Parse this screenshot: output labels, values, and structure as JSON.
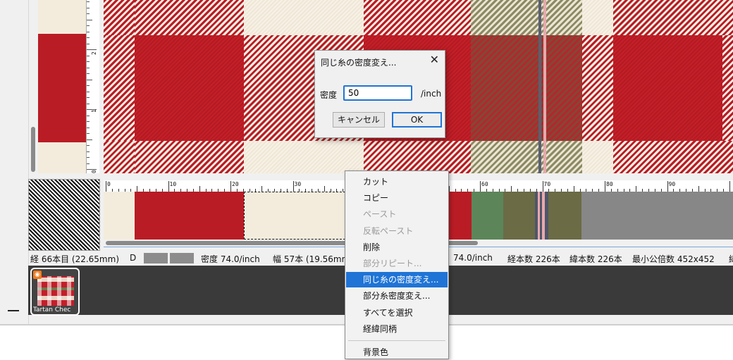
{
  "colors": {
    "red": "#b91c25",
    "cream": "#f3ecdd",
    "olive": "#6b6b45",
    "green": "#5c865a",
    "gray": "#878787",
    "accent": "#1f74d6"
  },
  "ruler_vertical": {
    "labels": [
      "2",
      "1",
      "0"
    ]
  },
  "ruler_horizontal": {
    "labels": [
      "0",
      "10",
      "20",
      "30",
      "40",
      "50",
      "60",
      "70",
      "80",
      "90"
    ]
  },
  "status": {
    "warp": "経 66本目 (22.65mm)",
    "d_label": "D",
    "density": "密度 74.0/inch",
    "width": "幅 57本 (19.56mm)",
    "density2": "74.0/inch",
    "warp_count": "経本数 226本",
    "weft_count": "緯本数 226本",
    "lcm": "最小公倍数 452x452",
    "trailing": "緯"
  },
  "gallery": {
    "items": [
      {
        "label": "Tartan Chec",
        "badge_icon": "app-badge-icon"
      }
    ]
  },
  "dialog": {
    "title": "同じ糸の密度変え...",
    "close_glyph": "✕",
    "field_label": "密度",
    "field_value": "50",
    "unit": "/inch",
    "cancel_label": "キャンセル",
    "ok_label": "OK"
  },
  "context_menu": {
    "items": [
      {
        "label": "カット",
        "state": "enabled"
      },
      {
        "label": "コピー",
        "state": "enabled"
      },
      {
        "label": "ペースト",
        "state": "disabled"
      },
      {
        "label": "反転ペースト",
        "state": "disabled"
      },
      {
        "label": "削除",
        "state": "enabled"
      },
      {
        "label": "部分リピート...",
        "state": "disabled"
      },
      {
        "label": "同じ糸の密度変え...",
        "state": "active"
      },
      {
        "label": "部分糸密度変え...",
        "state": "enabled"
      },
      {
        "label": "すべてを選択",
        "state": "enabled"
      },
      {
        "label": "経緯同柄",
        "state": "enabled"
      },
      {
        "label": "背景色",
        "state": "enabled"
      }
    ]
  }
}
